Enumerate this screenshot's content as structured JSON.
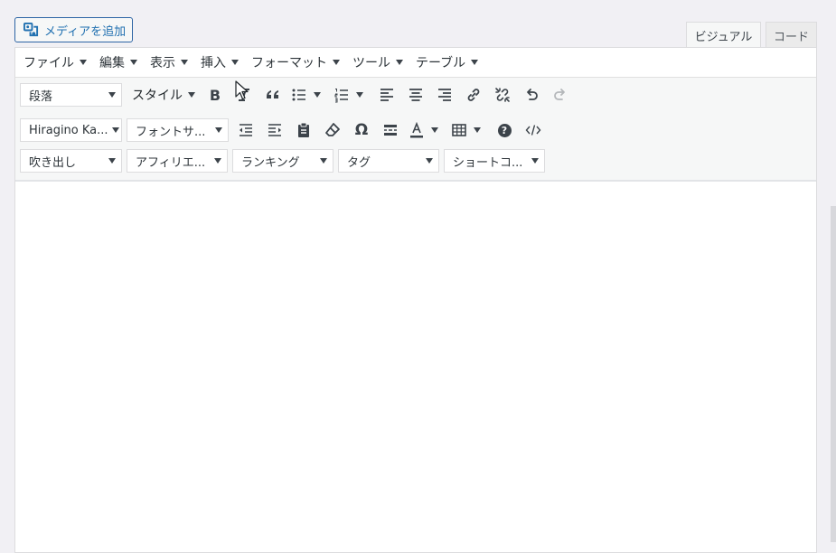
{
  "media_button": {
    "label": "メディアを追加"
  },
  "tabs": {
    "visual": "ビジュアル",
    "code": "コード"
  },
  "menubar": [
    {
      "label": "ファイル"
    },
    {
      "label": "編集"
    },
    {
      "label": "表示"
    },
    {
      "label": "挿入"
    },
    {
      "label": "フォーマット"
    },
    {
      "label": "ツール"
    },
    {
      "label": "テーブル"
    }
  ],
  "toolbar": {
    "format_select": "段落",
    "style_drop": "スタイル",
    "font_family": "Hiragino Ka...",
    "font_size": "フォントサ...",
    "row3": [
      {
        "label": "吹き出し"
      },
      {
        "label": "アフィリエ..."
      },
      {
        "label": "ランキング"
      },
      {
        "label": "タグ"
      },
      {
        "label": "ショートコ..."
      }
    ],
    "bold_glyph": "B",
    "omega_glyph": "Ω",
    "help_glyph": "?"
  },
  "colors": {
    "accent": "#2271b1",
    "toolbar_bg": "#f6f7f7",
    "page_bg": "#f1f0f4"
  }
}
